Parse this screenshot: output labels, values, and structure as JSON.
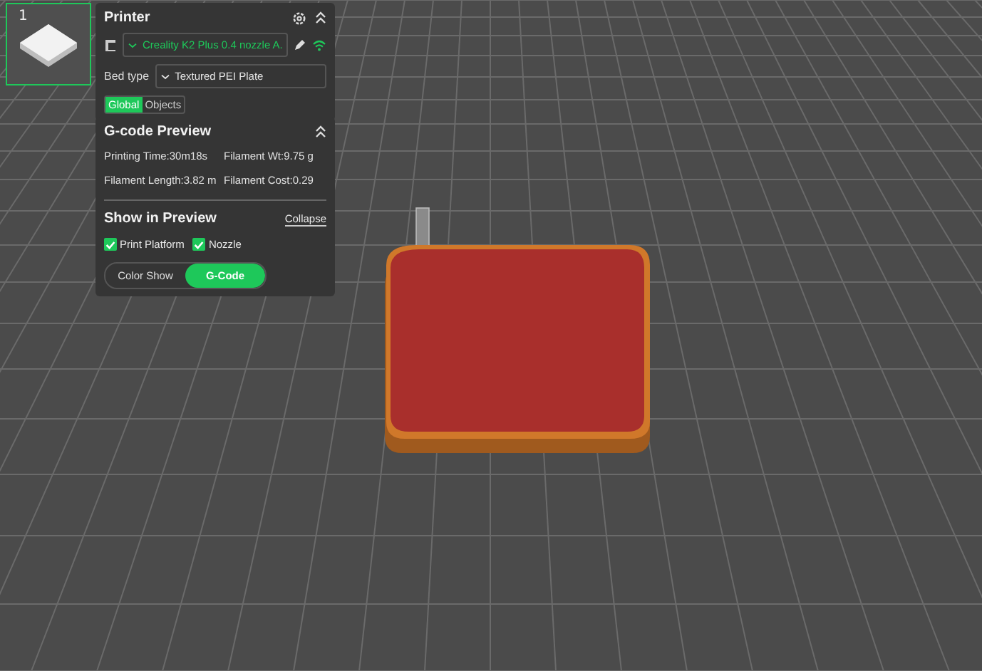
{
  "plate": {
    "number": "1",
    "selected": true
  },
  "printer": {
    "title": "Printer",
    "preset": "Creality K2 Plus 0.4 nozzle A.",
    "bed_label": "Bed type",
    "bed_value": "Textured PEI Plate",
    "tabs": [
      {
        "label": "Global",
        "selected": true
      },
      {
        "label": "Objects",
        "selected": false
      }
    ]
  },
  "gcode_preview": {
    "title": "G-code Preview",
    "stats": [
      {
        "label": "Printing Time:30m18s"
      },
      {
        "label": "Filament Wt:9.75 g"
      },
      {
        "label": "Filament Length:3.82 m"
      },
      {
        "label": "Filament Cost:0.29"
      }
    ]
  },
  "show_in_preview": {
    "title": "Show in Preview",
    "collapse": "Collapse",
    "options": [
      {
        "label": "Print Platform",
        "checked": true
      },
      {
        "label": "Nozzle",
        "checked": true
      }
    ],
    "modes": [
      {
        "label": "Color Show",
        "selected": false
      },
      {
        "label": "G-Code",
        "selected": true
      }
    ]
  }
}
